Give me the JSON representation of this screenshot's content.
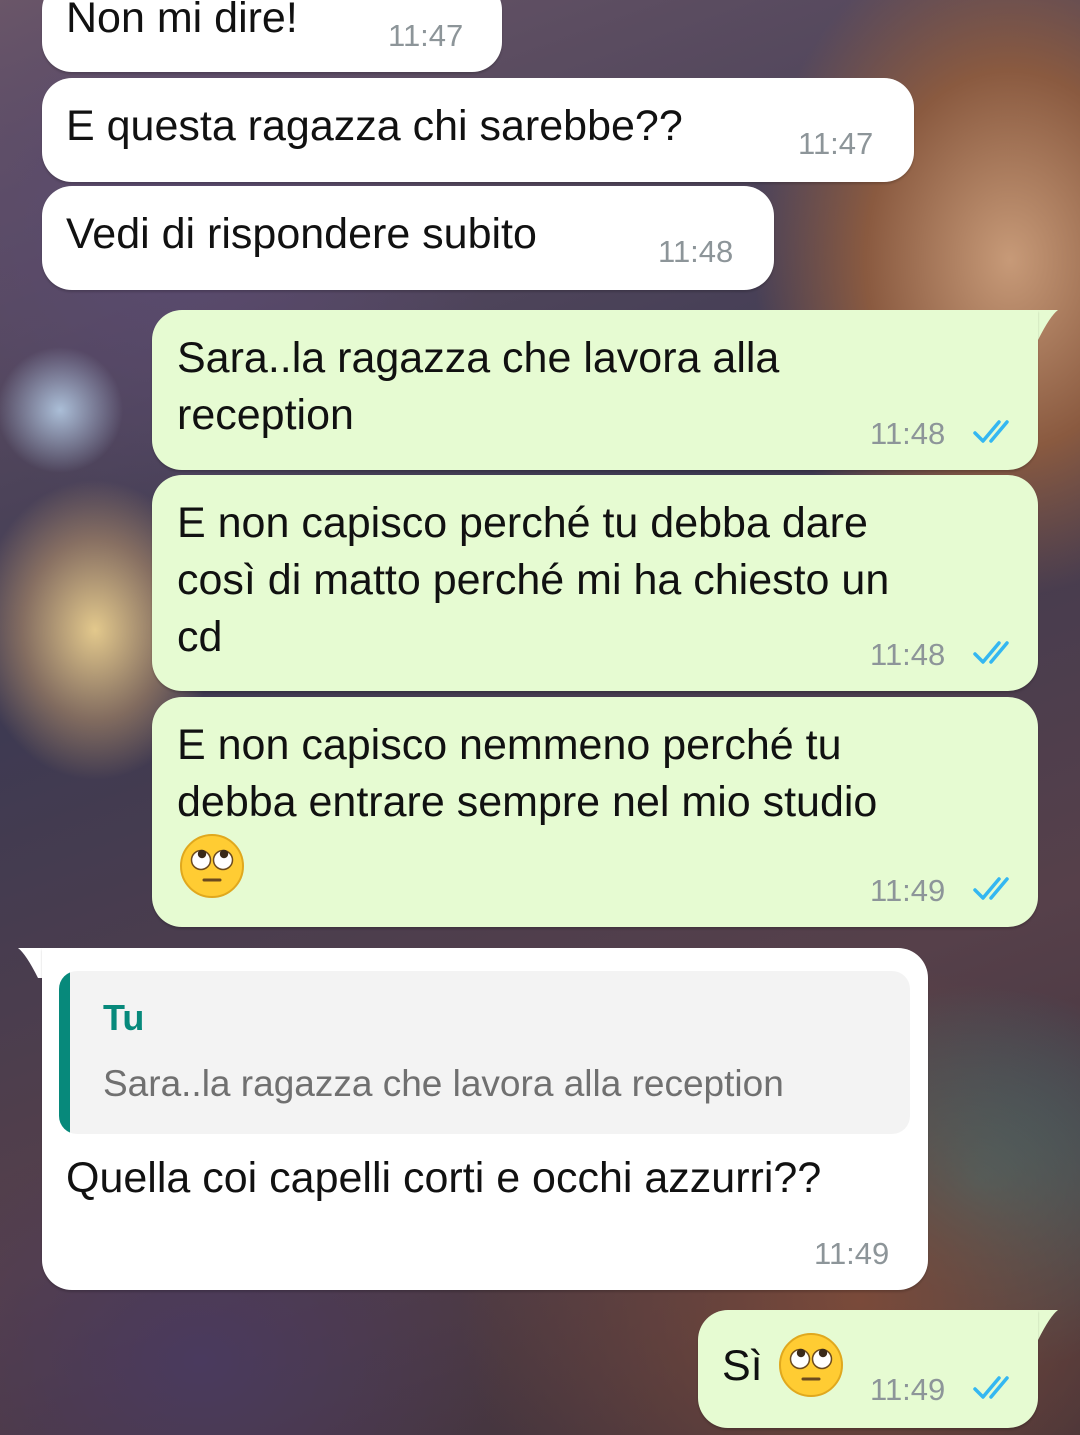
{
  "chat": {
    "messages": [
      {
        "direction": "incoming",
        "text": "Non mi dire!",
        "time": "11:47"
      },
      {
        "direction": "incoming",
        "text": "E questa ragazza chi sarebbe??",
        "time": "11:47"
      },
      {
        "direction": "incoming",
        "text": "Vedi di rispondere subito",
        "time": "11:48"
      },
      {
        "direction": "outgoing",
        "lines": [
          "Sara..la ragazza che lavora alla",
          "reception"
        ],
        "time": "11:48",
        "status": "read"
      },
      {
        "direction": "outgoing",
        "lines": [
          "E non capisco perché tu debba dare",
          "così di matto perché mi ha chiesto un",
          "cd"
        ],
        "time": "11:48",
        "status": "read"
      },
      {
        "direction": "outgoing",
        "lines": [
          "E non capisco nemmeno perché tu",
          "debba entrare sempre nel mio studio"
        ],
        "emoji": "face-with-rolling-eyes",
        "time": "11:49",
        "status": "read"
      },
      {
        "direction": "incoming",
        "quoted": {
          "author": "Tu",
          "text": "Sara..la ragazza che lavora alla reception"
        },
        "text": "Quella coi capelli corti e occhi azzurri??",
        "time": "11:49"
      },
      {
        "direction": "outgoing",
        "text": "Sì",
        "emoji": "face-with-rolling-eyes",
        "time": "11:49",
        "status": "read"
      }
    ]
  },
  "colors": {
    "incoming_bubble": "#ffffff",
    "outgoing_bubble": "#e6fbd2",
    "read_ticks": "#34b7f1",
    "quote_accent": "#07897b",
    "timestamp": "#8d9599"
  }
}
